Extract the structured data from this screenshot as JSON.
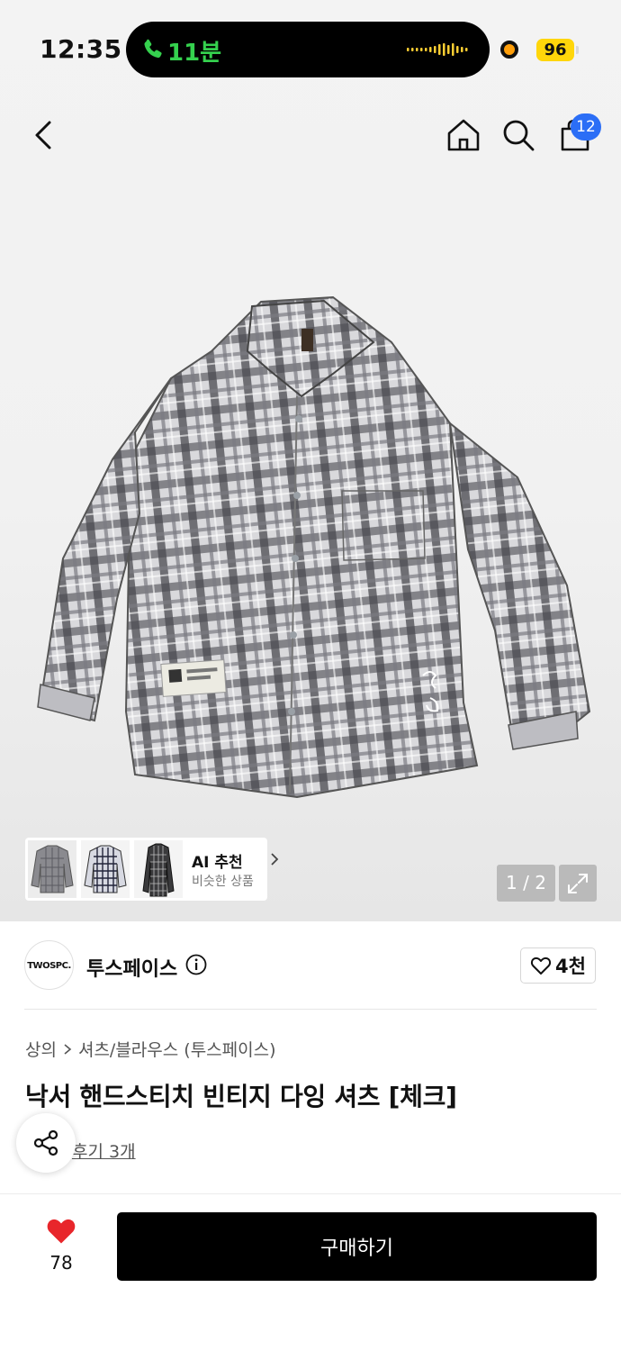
{
  "status_bar": {
    "time": "12:35",
    "call_duration": "11분",
    "battery": "96"
  },
  "header": {
    "cart_count": "12"
  },
  "gallery": {
    "ai": {
      "title": "AI 추천",
      "subtitle": "비슷한 상품"
    },
    "pager": "1 / 2"
  },
  "brand": {
    "logo_text": "TWOSPC.",
    "name": "투스페이스",
    "like_count": "4천"
  },
  "breadcrumb": {
    "category": "상의",
    "subcategory": "셔츠/블라우스 (투스페이스)"
  },
  "product": {
    "title": "낙서 핸드스티치 빈티지 다잉 셔츠 [체크]",
    "reviews_label": "후기 3개"
  },
  "bottom_bar": {
    "heart_count": "78",
    "buy_label": "구매하기"
  },
  "colors": {
    "accent_badge": "#2b6ef6",
    "heart": "#e8262b",
    "call_green": "#35d14e",
    "battery_yellow": "#ffd60a",
    "buy_button": "#000000"
  }
}
